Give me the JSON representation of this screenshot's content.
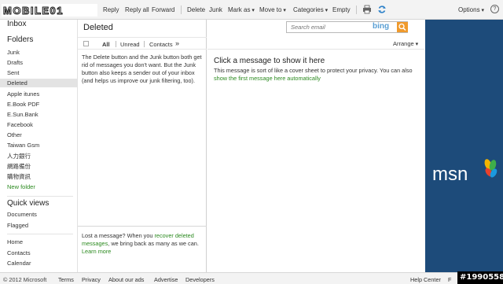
{
  "brand": {
    "logo_text": "MOBILE01"
  },
  "toolbar": {
    "reply": "Reply",
    "reply_all": "Reply all",
    "forward": "Forward",
    "delete": "Delete",
    "junk": "Junk",
    "mark_as": "Mark as",
    "move_to": "Move to",
    "categories": "Categories",
    "empty": "Empty",
    "options": "Options",
    "help": "?"
  },
  "sidebar": {
    "inbox": "Inbox",
    "folders_title": "Folders",
    "folders": [
      "Junk",
      "Drafts",
      "Sent",
      "Deleted",
      "Apple itunes",
      "E.Book PDF",
      "E.Sun.Bank",
      "Facebook",
      "Other",
      "Taiwan Gsm",
      "人力銀行",
      "網路備份",
      "購物資訊"
    ],
    "selected_folder": "Deleted",
    "new_folder": "New folder",
    "quick_views_title": "Quick views",
    "quick_views": [
      "Documents",
      "Flagged"
    ],
    "nav": [
      "Home",
      "Contacts",
      "Calendar"
    ]
  },
  "list": {
    "folder_title": "Deleted",
    "filters": [
      "All",
      "Unread",
      "Contacts"
    ],
    "more": "»",
    "info": "The Delete button and the Junk button both get rid of messages you don't want. But the Junk button also keeps a sender out of your inbox (and helps us improve our junk filtering, too).",
    "lost_prefix": "Lost a message? When you ",
    "lost_link": "recover deleted messages",
    "lost_middle": ", we bring back as many as we can. ",
    "learn_more": "Learn more"
  },
  "search": {
    "placeholder": "Search email",
    "engine": "bing"
  },
  "reading": {
    "arrange": "Arrange",
    "title": "Click a message to show it here",
    "desc": "This message is sort of like a cover sheet to protect your privacy. You can also ",
    "desc_link": "show the first message here automatically"
  },
  "ad": {
    "logo_text": "msn"
  },
  "footer": {
    "copyright": "© 2012 Microsoft",
    "links": [
      "Terms",
      "Privacy",
      "About our ads",
      "Advertise",
      "Developers"
    ],
    "help_center": "Help Center",
    "feedback_prefix": "F"
  },
  "watermark": "#1990558",
  "colors": {
    "link_green": "#2b8a1f",
    "ad_blue": "#1d4b7a",
    "bing_orange": "#f09a2c"
  }
}
